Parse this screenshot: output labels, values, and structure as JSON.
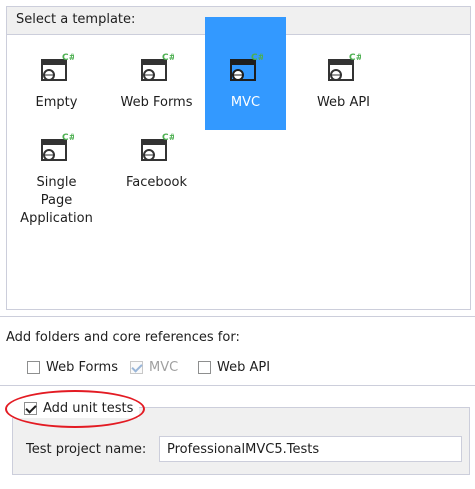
{
  "templates": {
    "header": "Select a template:",
    "items": [
      {
        "label": "Empty",
        "icon": "csharp-web-project-icon",
        "selected": false
      },
      {
        "label": "Web Forms",
        "icon": "csharp-web-project-icon",
        "selected": false
      },
      {
        "label": "MVC",
        "icon": "csharp-web-project-icon",
        "selected": true
      },
      {
        "label": "Web API",
        "icon": "csharp-web-project-icon",
        "selected": false
      },
      {
        "label": "Single Page Application",
        "icon": "csharp-web-project-icon",
        "selected": false
      },
      {
        "label": "Facebook",
        "icon": "csharp-web-project-icon",
        "selected": false
      }
    ],
    "badge": "C#"
  },
  "references": {
    "label": "Add folders and core references for:",
    "options": [
      {
        "label": "Web Forms",
        "checked": false,
        "enabled": true
      },
      {
        "label": "MVC",
        "checked": true,
        "enabled": false
      },
      {
        "label": "Web API",
        "checked": false,
        "enabled": true
      }
    ]
  },
  "unit_tests": {
    "label": "Add unit tests",
    "checked": true,
    "project_name_label": "Test project name:",
    "project_name_value": "ProfessionalMVC5.Tests"
  },
  "colors": {
    "selection": "#3399ff",
    "annotation": "#e31b23",
    "badge_green": "#4caf50"
  }
}
